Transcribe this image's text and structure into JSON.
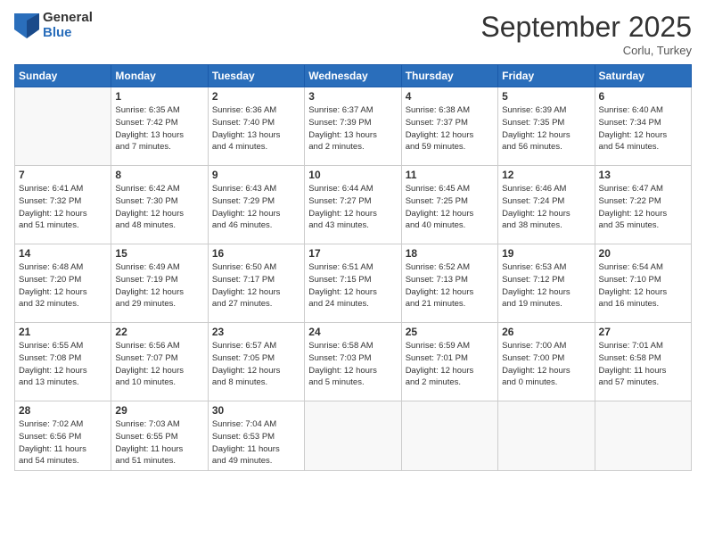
{
  "header": {
    "logo_general": "General",
    "logo_blue": "Blue",
    "month_title": "September 2025",
    "location": "Corlu, Turkey"
  },
  "days_of_week": [
    "Sunday",
    "Monday",
    "Tuesday",
    "Wednesday",
    "Thursday",
    "Friday",
    "Saturday"
  ],
  "weeks": [
    [
      {
        "day": "",
        "info": ""
      },
      {
        "day": "1",
        "info": "Sunrise: 6:35 AM\nSunset: 7:42 PM\nDaylight: 13 hours\nand 7 minutes."
      },
      {
        "day": "2",
        "info": "Sunrise: 6:36 AM\nSunset: 7:40 PM\nDaylight: 13 hours\nand 4 minutes."
      },
      {
        "day": "3",
        "info": "Sunrise: 6:37 AM\nSunset: 7:39 PM\nDaylight: 13 hours\nand 2 minutes."
      },
      {
        "day": "4",
        "info": "Sunrise: 6:38 AM\nSunset: 7:37 PM\nDaylight: 12 hours\nand 59 minutes."
      },
      {
        "day": "5",
        "info": "Sunrise: 6:39 AM\nSunset: 7:35 PM\nDaylight: 12 hours\nand 56 minutes."
      },
      {
        "day": "6",
        "info": "Sunrise: 6:40 AM\nSunset: 7:34 PM\nDaylight: 12 hours\nand 54 minutes."
      }
    ],
    [
      {
        "day": "7",
        "info": "Sunrise: 6:41 AM\nSunset: 7:32 PM\nDaylight: 12 hours\nand 51 minutes."
      },
      {
        "day": "8",
        "info": "Sunrise: 6:42 AM\nSunset: 7:30 PM\nDaylight: 12 hours\nand 48 minutes."
      },
      {
        "day": "9",
        "info": "Sunrise: 6:43 AM\nSunset: 7:29 PM\nDaylight: 12 hours\nand 46 minutes."
      },
      {
        "day": "10",
        "info": "Sunrise: 6:44 AM\nSunset: 7:27 PM\nDaylight: 12 hours\nand 43 minutes."
      },
      {
        "day": "11",
        "info": "Sunrise: 6:45 AM\nSunset: 7:25 PM\nDaylight: 12 hours\nand 40 minutes."
      },
      {
        "day": "12",
        "info": "Sunrise: 6:46 AM\nSunset: 7:24 PM\nDaylight: 12 hours\nand 38 minutes."
      },
      {
        "day": "13",
        "info": "Sunrise: 6:47 AM\nSunset: 7:22 PM\nDaylight: 12 hours\nand 35 minutes."
      }
    ],
    [
      {
        "day": "14",
        "info": "Sunrise: 6:48 AM\nSunset: 7:20 PM\nDaylight: 12 hours\nand 32 minutes."
      },
      {
        "day": "15",
        "info": "Sunrise: 6:49 AM\nSunset: 7:19 PM\nDaylight: 12 hours\nand 29 minutes."
      },
      {
        "day": "16",
        "info": "Sunrise: 6:50 AM\nSunset: 7:17 PM\nDaylight: 12 hours\nand 27 minutes."
      },
      {
        "day": "17",
        "info": "Sunrise: 6:51 AM\nSunset: 7:15 PM\nDaylight: 12 hours\nand 24 minutes."
      },
      {
        "day": "18",
        "info": "Sunrise: 6:52 AM\nSunset: 7:13 PM\nDaylight: 12 hours\nand 21 minutes."
      },
      {
        "day": "19",
        "info": "Sunrise: 6:53 AM\nSunset: 7:12 PM\nDaylight: 12 hours\nand 19 minutes."
      },
      {
        "day": "20",
        "info": "Sunrise: 6:54 AM\nSunset: 7:10 PM\nDaylight: 12 hours\nand 16 minutes."
      }
    ],
    [
      {
        "day": "21",
        "info": "Sunrise: 6:55 AM\nSunset: 7:08 PM\nDaylight: 12 hours\nand 13 minutes."
      },
      {
        "day": "22",
        "info": "Sunrise: 6:56 AM\nSunset: 7:07 PM\nDaylight: 12 hours\nand 10 minutes."
      },
      {
        "day": "23",
        "info": "Sunrise: 6:57 AM\nSunset: 7:05 PM\nDaylight: 12 hours\nand 8 minutes."
      },
      {
        "day": "24",
        "info": "Sunrise: 6:58 AM\nSunset: 7:03 PM\nDaylight: 12 hours\nand 5 minutes."
      },
      {
        "day": "25",
        "info": "Sunrise: 6:59 AM\nSunset: 7:01 PM\nDaylight: 12 hours\nand 2 minutes."
      },
      {
        "day": "26",
        "info": "Sunrise: 7:00 AM\nSunset: 7:00 PM\nDaylight: 12 hours\nand 0 minutes."
      },
      {
        "day": "27",
        "info": "Sunrise: 7:01 AM\nSunset: 6:58 PM\nDaylight: 11 hours\nand 57 minutes."
      }
    ],
    [
      {
        "day": "28",
        "info": "Sunrise: 7:02 AM\nSunset: 6:56 PM\nDaylight: 11 hours\nand 54 minutes."
      },
      {
        "day": "29",
        "info": "Sunrise: 7:03 AM\nSunset: 6:55 PM\nDaylight: 11 hours\nand 51 minutes."
      },
      {
        "day": "30",
        "info": "Sunrise: 7:04 AM\nSunset: 6:53 PM\nDaylight: 11 hours\nand 49 minutes."
      },
      {
        "day": "",
        "info": ""
      },
      {
        "day": "",
        "info": ""
      },
      {
        "day": "",
        "info": ""
      },
      {
        "day": "",
        "info": ""
      }
    ]
  ]
}
